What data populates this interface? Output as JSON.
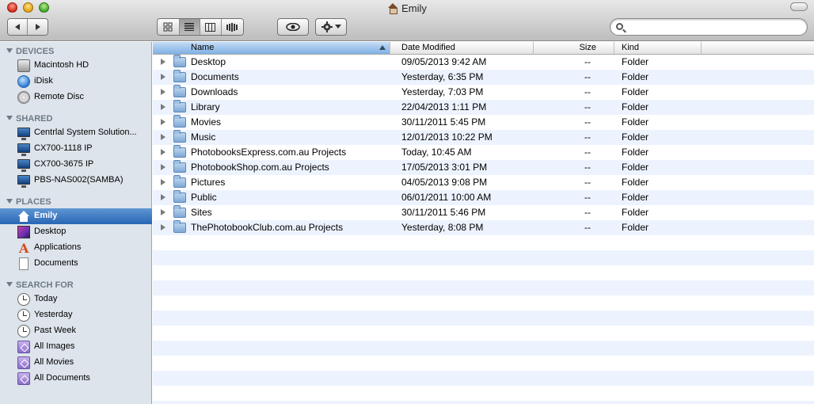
{
  "window": {
    "title": "Emily"
  },
  "toolbar": {
    "back_icon": "chevron-left-icon",
    "forward_icon": "chevron-right-icon",
    "views": [
      "icon-view-icon",
      "list-view-icon",
      "column-view-icon",
      "coverflow-view-icon"
    ],
    "active_view": "list",
    "quicklook_icon": "eye-icon",
    "action_icon": "gear-icon",
    "search": {
      "value": "",
      "placeholder": ""
    }
  },
  "sidebar": {
    "devices": {
      "header": "DEVICES",
      "items": [
        {
          "label": "Macintosh HD",
          "icon": "hard-drive-icon"
        },
        {
          "label": "iDisk",
          "icon": "globe-icon"
        },
        {
          "label": "Remote Disc",
          "icon": "disc-icon"
        }
      ]
    },
    "shared": {
      "header": "SHARED",
      "items": [
        {
          "label": "Centrlal System Solution...",
          "icon": "monitor-icon"
        },
        {
          "label": "CX700-1118 IP",
          "icon": "monitor-icon"
        },
        {
          "label": "CX700-3675 IP",
          "icon": "monitor-icon"
        },
        {
          "label": "PBS-NAS002(SAMBA)",
          "icon": "monitor-icon"
        }
      ]
    },
    "places": {
      "header": "PLACES",
      "items": [
        {
          "label": "Emily",
          "icon": "home-icon",
          "selected": true
        },
        {
          "label": "Desktop",
          "icon": "desktop-icon"
        },
        {
          "label": "Applications",
          "icon": "applications-icon"
        },
        {
          "label": "Documents",
          "icon": "document-icon"
        }
      ]
    },
    "search_for": {
      "header": "SEARCH FOR",
      "items": [
        {
          "label": "Today",
          "icon": "clock-icon"
        },
        {
          "label": "Yesterday",
          "icon": "clock-icon"
        },
        {
          "label": "Past Week",
          "icon": "clock-icon"
        },
        {
          "label": "All Images",
          "icon": "smart-folder-icon"
        },
        {
          "label": "All Movies",
          "icon": "smart-folder-icon"
        },
        {
          "label": "All Documents",
          "icon": "smart-folder-icon"
        }
      ]
    }
  },
  "list": {
    "columns": {
      "name": "Name",
      "date": "Date Modified",
      "size": "Size",
      "kind": "Kind"
    },
    "sorted_by": "name",
    "rows": [
      {
        "name": "Desktop",
        "date": "09/05/2013 9:42 AM",
        "size": "--",
        "kind": "Folder"
      },
      {
        "name": "Documents",
        "date": "Yesterday, 6:35 PM",
        "size": "--",
        "kind": "Folder"
      },
      {
        "name": "Downloads",
        "date": "Yesterday, 7:03 PM",
        "size": "--",
        "kind": "Folder"
      },
      {
        "name": "Library",
        "date": "22/04/2013 1:11 PM",
        "size": "--",
        "kind": "Folder"
      },
      {
        "name": "Movies",
        "date": "30/11/2011 5:45 PM",
        "size": "--",
        "kind": "Folder"
      },
      {
        "name": "Music",
        "date": "12/01/2013 10:22 PM",
        "size": "--",
        "kind": "Folder"
      },
      {
        "name": "PhotobooksExpress.com.au Projects",
        "date": "Today, 10:45 AM",
        "size": "--",
        "kind": "Folder"
      },
      {
        "name": "PhotobookShop.com.au Projects",
        "date": "17/05/2013 3:01 PM",
        "size": "--",
        "kind": "Folder"
      },
      {
        "name": "Pictures",
        "date": "04/05/2013 9:08 PM",
        "size": "--",
        "kind": "Folder"
      },
      {
        "name": "Public",
        "date": "06/01/2011 10:00 AM",
        "size": "--",
        "kind": "Folder"
      },
      {
        "name": "Sites",
        "date": "30/11/2011 5:46 PM",
        "size": "--",
        "kind": "Folder"
      },
      {
        "name": "ThePhotobookClub.com.au Projects",
        "date": "Yesterday, 8:08 PM",
        "size": "--",
        "kind": "Folder"
      }
    ]
  }
}
